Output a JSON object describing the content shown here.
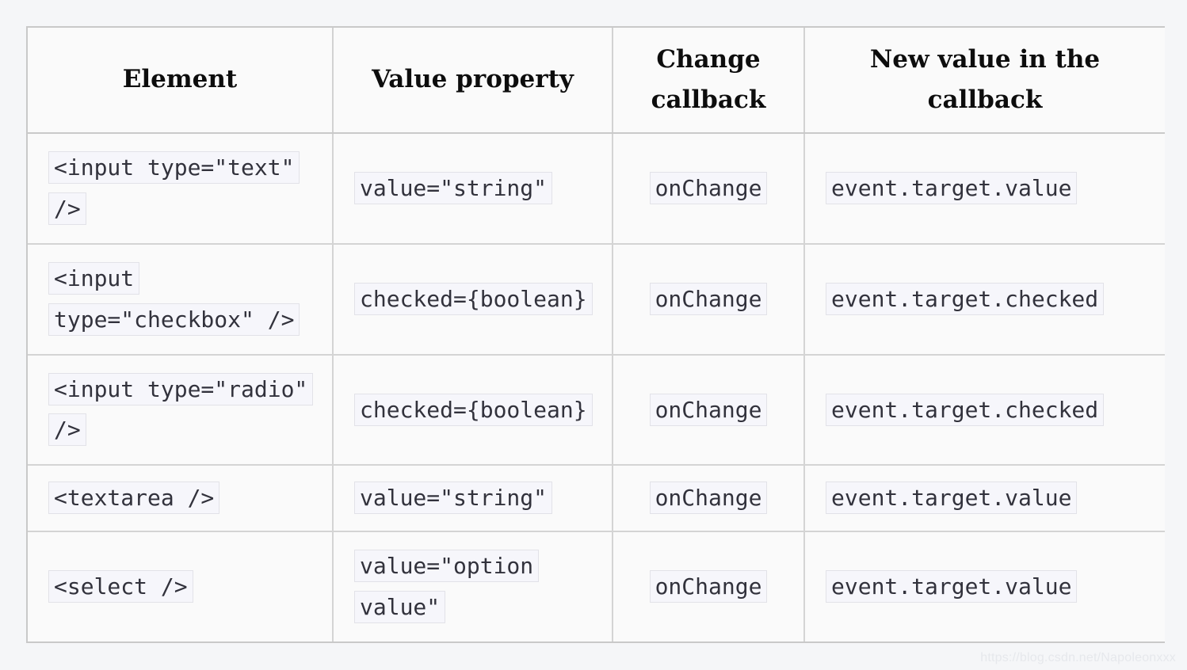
{
  "page": {
    "background_color": "#f5f6f8",
    "table_background_color": "#fafafa",
    "outer_border_color": "#c9c9c9",
    "inner_border_color": "#d4d4d4",
    "code_chip_background": "#f6f6fb",
    "code_chip_border": "#e2e2e8",
    "code_text_color": "#32323c",
    "header_text_color": "#0d0d0d"
  },
  "table": {
    "headers": [
      {
        "label": "Element"
      },
      {
        "label": "Value property"
      },
      {
        "label": "Change callback"
      },
      {
        "label": "New value in the callback"
      }
    ],
    "rows": [
      {
        "element": "<input type=\"text\" />",
        "value_property": "value=\"string\"",
        "change_callback": "onChange",
        "new_value": "event.target.value"
      },
      {
        "element": "<input type=\"checkbox\" />",
        "value_property": "checked={boolean}",
        "change_callback": "onChange",
        "new_value": "event.target.checked"
      },
      {
        "element": "<input type=\"radio\" />",
        "value_property": "checked={boolean}",
        "change_callback": "onChange",
        "new_value": "event.target.checked"
      },
      {
        "element": "<textarea />",
        "value_property": "value=\"string\"",
        "change_callback": "onChange",
        "new_value": "event.target.value"
      },
      {
        "element": "<select />",
        "value_property": "value=\"option value\"",
        "change_callback": "onChange",
        "new_value": "event.target.value"
      }
    ]
  },
  "watermark": {
    "text": "https://blog.csdn.net/Napoleonxxx"
  }
}
